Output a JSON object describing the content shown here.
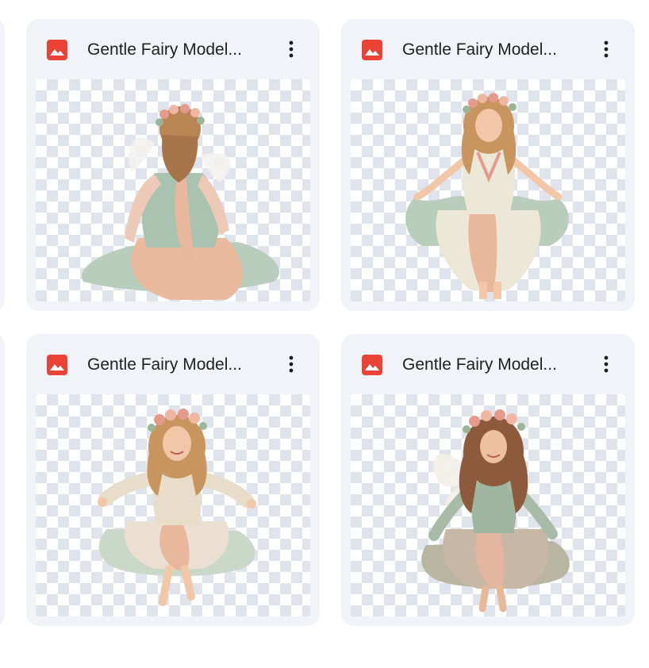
{
  "files": [
    {
      "name": "Gentle Fairy Model...",
      "icon": "image-file-icon"
    },
    {
      "name": "Gentle Fairy Model...",
      "icon": "image-file-icon"
    },
    {
      "name": "Gentle Fairy Model...",
      "icon": "image-file-icon"
    },
    {
      "name": "Gentle Fairy Model...",
      "icon": "image-file-icon"
    }
  ],
  "colors": {
    "card_bg": "#f0f4f9",
    "icon_red": "#ea4335",
    "text": "#1f1f1f",
    "dress_green": "#a9c3b0",
    "dress_peach": "#e8b79c",
    "hair": "#b98555",
    "skin": "#f1c7a8",
    "flower": "#e59a8c"
  }
}
